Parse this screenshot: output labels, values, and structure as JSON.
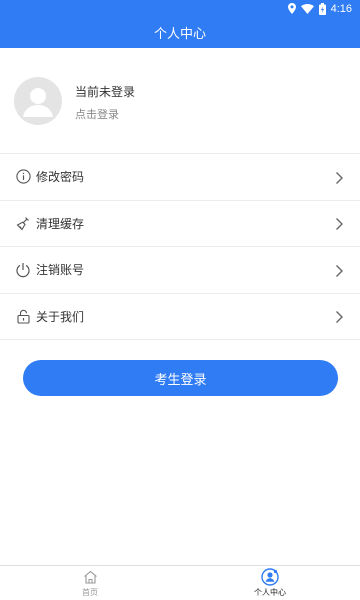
{
  "status_bar": {
    "time": "4:16",
    "icons": [
      "location-icon",
      "wifi-icon",
      "battery-icon"
    ]
  },
  "app_bar": {
    "title": "个人中心"
  },
  "profile": {
    "title": "当前未登录",
    "subtitle": "点击登录"
  },
  "menu": {
    "items": [
      {
        "label": "修改密码",
        "icon": "info-icon"
      },
      {
        "label": "清理缓存",
        "icon": "broom-icon"
      },
      {
        "label": "注销账号",
        "icon": "power-icon"
      },
      {
        "label": "关于我们",
        "icon": "lock-icon"
      }
    ]
  },
  "login_button": {
    "label": "考生登录"
  },
  "tab_bar": {
    "tabs": [
      {
        "label": "首页",
        "icon": "home-icon",
        "active": false
      },
      {
        "label": "个人中心",
        "icon": "user-icon",
        "active": true
      }
    ]
  },
  "colors": {
    "primary": "#2f7cf4",
    "divider": "#ececec",
    "text": "#333333",
    "muted": "#888888"
  }
}
